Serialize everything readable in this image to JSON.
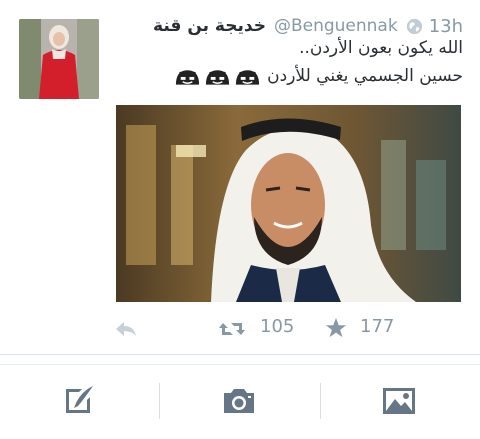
{
  "colors": {
    "text_primary": "#292f33",
    "text_secondary": "#8899a6",
    "icon_gray": "#8899a6",
    "toolbar_icon": "#657786",
    "divider": "#d8dee3"
  },
  "tweet": {
    "display_name": "خديجة بن قنة",
    "handle": "@Benguennak",
    "time": "13h",
    "line1": "الله يكون بعون الأردن..",
    "line2": "حسين الجسمي يغني للأردن",
    "emoji_count": 3,
    "icons": {
      "globe": "globe-icon",
      "emoji": "crying-laughing-emoji-icon"
    }
  },
  "actions": {
    "retweet_count": "105",
    "favorite_count": "177",
    "icons": [
      "reply-icon",
      "retweet-icon",
      "favorite-star-icon"
    ]
  },
  "toolbar": {
    "icons": [
      "compose-icon",
      "camera-icon",
      "image-icon"
    ]
  }
}
